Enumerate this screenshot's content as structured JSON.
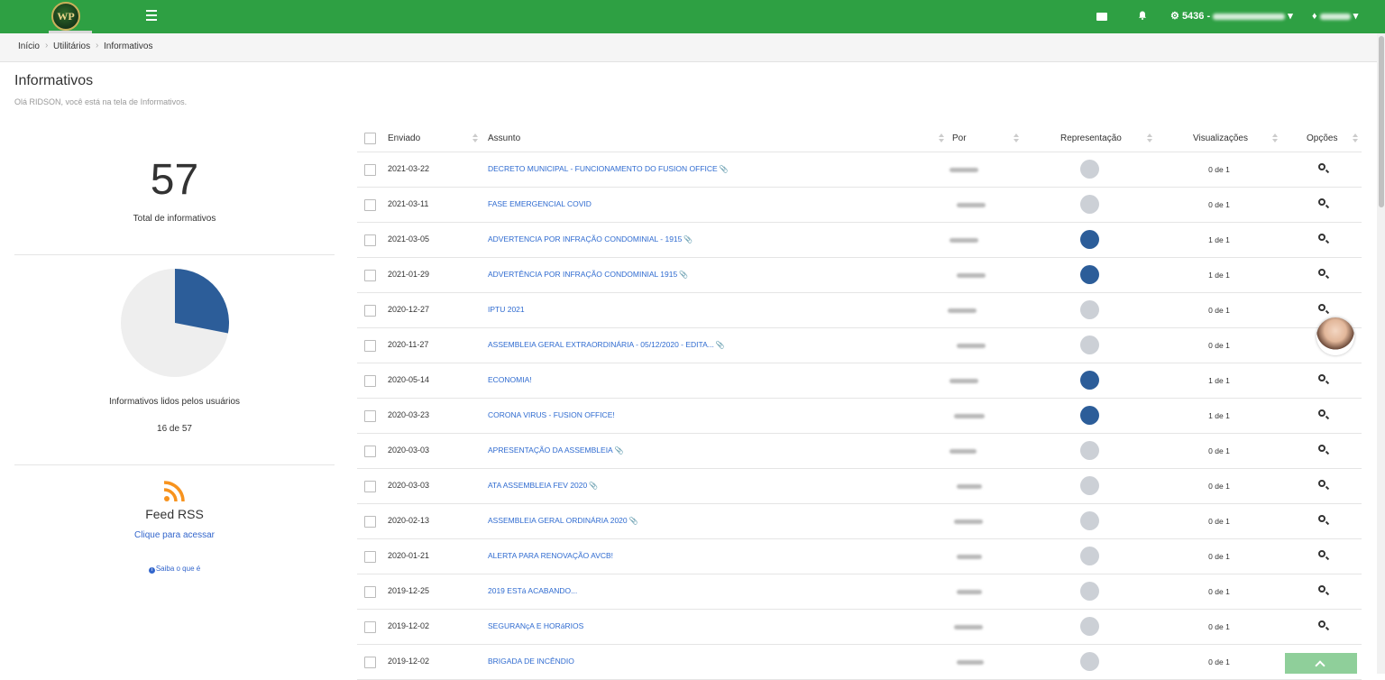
{
  "header": {
    "logo_text": "WP",
    "company_code": "5436 -",
    "company_name": "FUSION OFFICE",
    "user_name": "RIDSON",
    "colors": {
      "bar": "#2ea043"
    },
    "icons": [
      "menu-icon",
      "envelope-icon",
      "bell-icon",
      "gear-icon",
      "user-icon"
    ]
  },
  "breadcrumb": {
    "items": [
      "Início",
      "Utilitários",
      "Informativos"
    ]
  },
  "page": {
    "title": "Informativos",
    "subtitle": "Olá RIDSON, você está na tela de Informativos."
  },
  "stats": {
    "total": "57",
    "total_label": "Total de informativos",
    "read_label": "Informativos lidos pelos usuários",
    "read_count": "16 de 57",
    "read_fraction": 0.2807
  },
  "rss": {
    "title": "Feed RSS",
    "link": "Clique para acessar",
    "help": "Saiba o que é"
  },
  "table": {
    "columns": [
      "Enviado",
      "Assunto",
      "Por",
      "Representação",
      "Visualizações",
      "Opções"
    ],
    "rows": [
      {
        "date": "2021-03-22",
        "subject": "DECRETO MUNICIPAL - FUNCIONAMENTO DO FUSION OFFICE",
        "attach": true,
        "read": false,
        "views": "0 de 1"
      },
      {
        "date": "2021-03-11",
        "subject": "FASE EMERGENCIAL COVID",
        "attach": false,
        "read": false,
        "views": "0 de 1"
      },
      {
        "date": "2021-03-05",
        "subject": "ADVERTENCIA POR INFRAÇÃO CONDOMINIAL - 1915",
        "attach": true,
        "read": true,
        "views": "1 de 1"
      },
      {
        "date": "2021-01-29",
        "subject": "ADVERTÊNCIA POR INFRAÇÃO CONDOMINIAL 1915",
        "attach": true,
        "read": true,
        "views": "1 de 1"
      },
      {
        "date": "2020-12-27",
        "subject": "IPTU 2021",
        "attach": false,
        "read": false,
        "views": "0 de 1"
      },
      {
        "date": "2020-11-27",
        "subject": "ASSEMBLEIA GERAL EXTRAORDINÁRIA - 05/12/2020 - EDITA...",
        "attach": true,
        "read": false,
        "views": "0 de 1"
      },
      {
        "date": "2020-05-14",
        "subject": "ECONOMIA!",
        "attach": false,
        "read": true,
        "views": "1 de 1"
      },
      {
        "date": "2020-03-23",
        "subject": "CORONA VIRUS - FUSION OFFICE!",
        "attach": false,
        "read": true,
        "views": "1 de 1"
      },
      {
        "date": "2020-03-03",
        "subject": "APRESENTAÇÃO DA ASSEMBLEIA",
        "attach": true,
        "read": false,
        "views": "0 de 1"
      },
      {
        "date": "2020-03-03",
        "subject": "ATA ASSEMBLEIA FEV 2020",
        "attach": true,
        "read": false,
        "views": "0 de 1"
      },
      {
        "date": "2020-02-13",
        "subject": "ASSEMBLEIA GERAL ORDINÁRIA 2020",
        "attach": true,
        "read": false,
        "views": "0 de 1"
      },
      {
        "date": "2020-01-21",
        "subject": "ALERTA PARA RENOVAÇÃO AVCB!",
        "attach": false,
        "read": false,
        "views": "0 de 1"
      },
      {
        "date": "2019-12-25",
        "subject": "2019 ESTá ACABANDO...",
        "attach": false,
        "read": false,
        "views": "0 de 1"
      },
      {
        "date": "2019-12-02",
        "subject": "SEGURANçA E HORáRIOS",
        "attach": false,
        "read": false,
        "views": "0 de 1"
      },
      {
        "date": "2019-12-02",
        "subject": "BRIGADA DE INCÊNDIO",
        "attach": false,
        "read": false,
        "views": "0 de 1"
      }
    ],
    "colors": {
      "read_dot": "#2c5d99",
      "unread_dot": "#ccd0d6",
      "link": "#2f6bd0"
    }
  }
}
